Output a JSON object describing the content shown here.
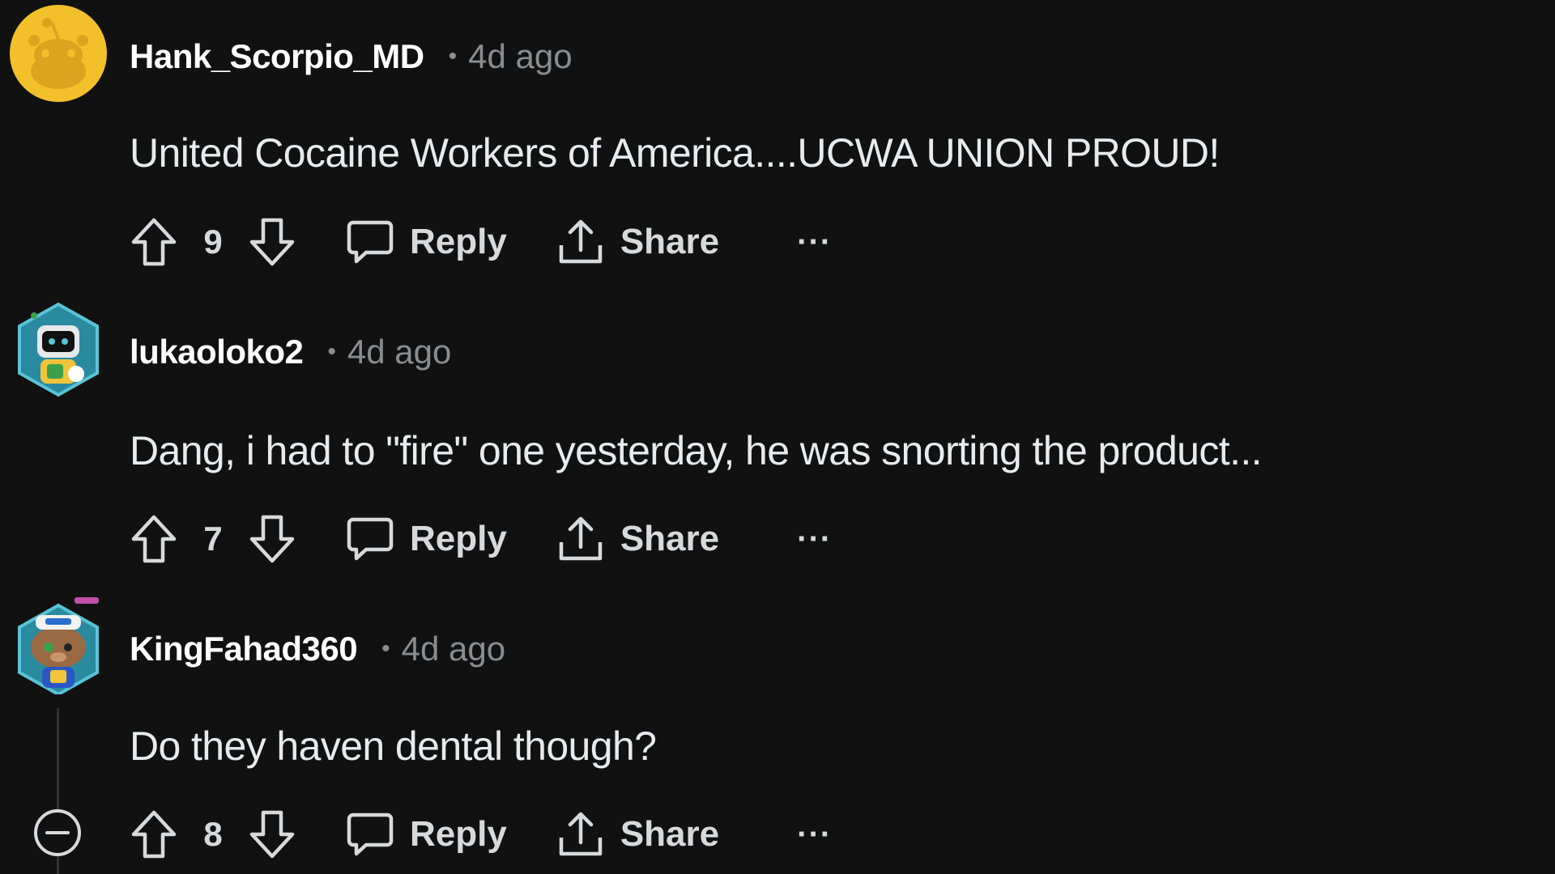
{
  "colors": {
    "background": "#111111",
    "username": "#ffffff",
    "muted": "#8a8d8f",
    "text": "#e8eaeb"
  },
  "comments": [
    {
      "username": "Hank_Scorpio_MD",
      "separator": "•",
      "time": "4d ago",
      "body": "United Cocaine Workers of America....UCWA UNION PROUD!",
      "score": "9",
      "reply_label": "Reply",
      "share_label": "Share",
      "more_label": "···",
      "avatar": "snoo-default-yellow-avatar"
    },
    {
      "username": "lukaoloko2",
      "separator": "•",
      "time": "4d ago",
      "body": "Dang, i had to \"fire\" one yesterday, he was snorting the product...",
      "score": "7",
      "reply_label": "Reply",
      "share_label": "Share",
      "more_label": "···",
      "avatar": "robot-snoo-hex-avatar"
    },
    {
      "username": "KingFahad360",
      "separator": "•",
      "time": "4d ago",
      "body": "Do they haven dental though?",
      "score": "8",
      "reply_label": "Reply",
      "share_label": "Share",
      "more_label": "···",
      "avatar": "sailor-snoo-hex-avatar"
    }
  ]
}
